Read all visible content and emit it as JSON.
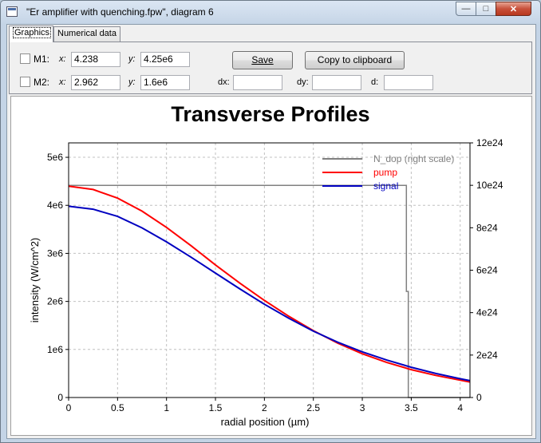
{
  "window": {
    "title": "\"Er amplifier with quenching.fpw\", diagram 6",
    "minimize_glyph": "—",
    "maximize_glyph": "□",
    "close_glyph": "✕"
  },
  "tabs": [
    {
      "label": "Graphics",
      "active": true
    },
    {
      "label": "Numerical data",
      "active": false
    }
  ],
  "markers": {
    "m1": {
      "label": "M1:",
      "checked": false,
      "x_label": "x:",
      "x_value": "4.238",
      "y_label": "y:",
      "y_value": "4.25e6"
    },
    "m2": {
      "label": "M2:",
      "checked": false,
      "x_label": "x:",
      "x_value": "2.962",
      "y_label": "y:",
      "y_value": "1.6e6"
    },
    "dx_label": "dx:",
    "dx_value": "",
    "dy_label": "dy:",
    "dy_value": "",
    "d_label": "d:",
    "d_value": ""
  },
  "buttons": {
    "save": "Save",
    "copy": "Copy to clipboard"
  },
  "chart_data": {
    "type": "line",
    "title": "Transverse Profiles",
    "xlabel": "radial position (µm)",
    "ylabel": "intensity (W/cm^2)",
    "xlim": [
      0,
      4.1
    ],
    "ylim": [
      0,
      5300000.0
    ],
    "y2lim": [
      0,
      1.2e+25
    ],
    "grid": true,
    "legend_position": "top-right",
    "x_ticks": [
      "0",
      "0.5",
      "1",
      "1.5",
      "2",
      "2.5",
      "3",
      "3.5",
      "4"
    ],
    "x_tick_values": [
      0,
      0.5,
      1,
      1.5,
      2,
      2.5,
      3,
      3.5,
      4
    ],
    "y_ticks": [
      "0",
      "1e6",
      "2e6",
      "3e6",
      "4e6",
      "5e6"
    ],
    "y_tick_values": [
      0,
      1000000.0,
      2000000.0,
      3000000.0,
      4000000.0,
      5000000.0
    ],
    "y2_ticks": [
      "0",
      "2e24",
      "4e24",
      "6e24",
      "8e24",
      "10e24",
      "12e24"
    ],
    "y2_tick_values": [
      0,
      2e+24,
      4e+24,
      6e+24,
      8e+24,
      1e+25,
      1.2e+25
    ],
    "series": [
      {
        "name": "N_dop (right scale)",
        "color": "#808080",
        "axis": "right",
        "x": [
          0,
          3.45,
          3.45,
          3.47,
          3.47,
          3.49,
          4.1
        ],
        "y": [
          1e+25,
          1e+25,
          5e+24,
          5e+24,
          0,
          0,
          0
        ]
      },
      {
        "name": "pump",
        "color": "#ff0000",
        "axis": "left",
        "x": [
          0,
          0.25,
          0.5,
          0.75,
          1.0,
          1.25,
          1.5,
          1.75,
          2.0,
          2.25,
          2.5,
          2.75,
          3.0,
          3.25,
          3.5,
          3.75,
          4.0,
          4.1
        ],
        "y": [
          4400000.0,
          4330000.0,
          4150000.0,
          3880000.0,
          3540000.0,
          3160000.0,
          2760000.0,
          2380000.0,
          2020000.0,
          1690000.0,
          1390000.0,
          1130000.0,
          910000.0,
          730000.0,
          580000.0,
          460000.0,
          360000.0,
          320000.0
        ]
      },
      {
        "name": "signal",
        "color": "#0000c0",
        "axis": "left",
        "x": [
          0,
          0.25,
          0.5,
          0.75,
          1.0,
          1.25,
          1.5,
          1.75,
          2.0,
          2.25,
          2.5,
          2.75,
          3.0,
          3.25,
          3.5,
          3.75,
          4.0,
          4.1
        ],
        "y": [
          3980000.0,
          3920000.0,
          3770000.0,
          3530000.0,
          3240000.0,
          2920000.0,
          2590000.0,
          2260000.0,
          1940000.0,
          1650000.0,
          1380000.0,
          1150000.0,
          950000.0,
          780000.0,
          630000.0,
          500000.0,
          390000.0,
          350000.0
        ]
      }
    ]
  }
}
